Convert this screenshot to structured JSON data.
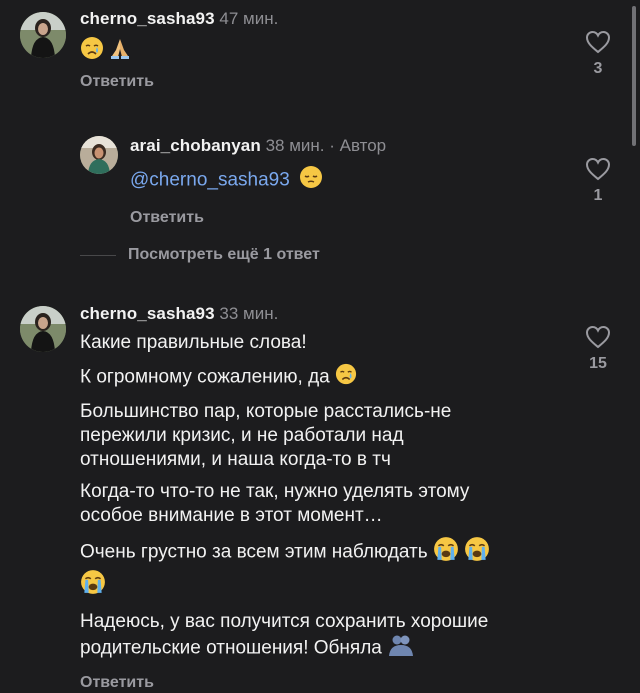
{
  "comments": [
    {
      "username": "cherno_sasha93",
      "time": "47 мин.",
      "emoji": [
        "face-crying-tear",
        "folded-hands"
      ],
      "reply_label": "Ответить",
      "likes": "3"
    },
    {
      "username": "arai_chobanyan",
      "time": "38 мин.",
      "author_label": "· Автор",
      "mention": "@cherno_sasha93",
      "emoji": [
        "pensive-face"
      ],
      "reply_label": "Ответить",
      "likes": "1"
    },
    {
      "username": "cherno_sasha93",
      "time": "33 мин.",
      "lines": [
        "Какие правильные слова!",
        "К огромному сожалению, да",
        "Большинство пар, которые расстались-не",
        "пережили кризис, и не работали над",
        "отношениями, и наша когда-то в тч",
        "Когда-то что-то не так, нужно уделять этому",
        "особое внимание в этот момент…",
        "Очень грустно за всем этим наблюдать",
        "Надеюсь, у вас получится сохранить хорошие",
        "родительские отношения! Обняла"
      ],
      "reply_label": "Ответить",
      "likes": "15"
    }
  ],
  "view_more": "Посмотреть ещё 1 ответ",
  "colors": {
    "background": "#1c1c1e",
    "text": "#f2f2f2",
    "muted": "#8e8e93",
    "mention": "#7aa8ee"
  }
}
